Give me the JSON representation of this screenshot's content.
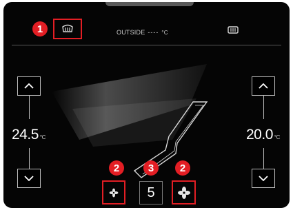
{
  "callouts": {
    "rear_defrost": "1",
    "fan_low": "2",
    "fan_level": "3",
    "fan_high": "2"
  },
  "top_bar": {
    "outside_label": "OUTSIDE",
    "outside_temp": "----",
    "outside_unit": "°C",
    "rear_defrost_icon": "rear-defrost-icon",
    "front_defrost_icon": "front-defrost-icon"
  },
  "left_zone": {
    "temperature": "24.5",
    "unit": "°C"
  },
  "right_zone": {
    "temperature": "20.0",
    "unit": "°C"
  },
  "fan": {
    "level": "5",
    "decrease_icon": "fan-small-icon",
    "increase_icon": "fan-large-icon"
  },
  "colors": {
    "screen": "#050505",
    "callout": "#e31e24",
    "outline": "#bdbdbd"
  }
}
